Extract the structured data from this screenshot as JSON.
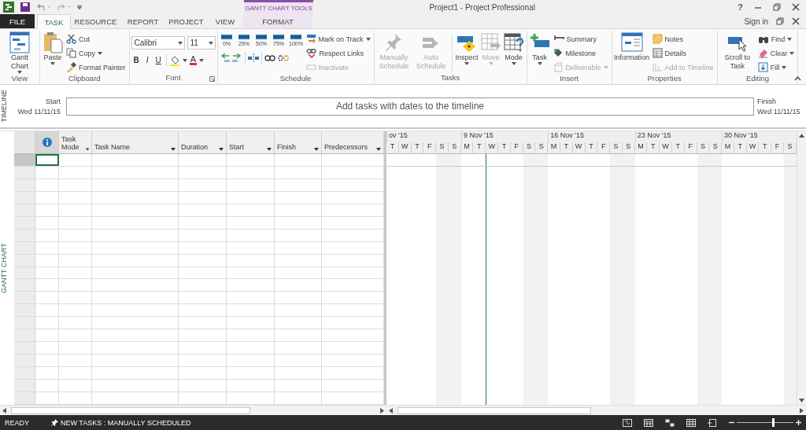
{
  "title_bar": {
    "contextual_group": "GANTT CHART TOOLS",
    "title": "Project1 - Project Professional",
    "help": "?"
  },
  "tabs": [
    {
      "label": "FILE",
      "kind": "file",
      "selected": false
    },
    {
      "label": "TASK",
      "kind": "normal",
      "selected": true
    },
    {
      "label": "RESOURCE",
      "kind": "normal",
      "selected": false
    },
    {
      "label": "REPORT",
      "kind": "normal",
      "selected": false
    },
    {
      "label": "PROJECT",
      "kind": "normal",
      "selected": false
    },
    {
      "label": "VIEW",
      "kind": "normal",
      "selected": false
    },
    {
      "label": "FORMAT",
      "kind": "contextual",
      "selected": false
    }
  ],
  "account": {
    "sign_in": "Sign in"
  },
  "ribbon_groups": [
    {
      "label": "View",
      "items": [
        {
          "kind": "large",
          "label": "Gantt Chart",
          "dropdown": true,
          "disabled": false
        }
      ]
    },
    {
      "label": "Clipboard",
      "items": [
        {
          "kind": "large",
          "label": "Paste",
          "dropdown": true,
          "disabled": false
        },
        {
          "kind": "stack",
          "entries": [
            {
              "label": "Cut",
              "dropdown": false,
              "disabled": false
            },
            {
              "label": "Copy",
              "dropdown": true,
              "disabled": false
            },
            {
              "label": "Format Painter",
              "dropdown": false,
              "disabled": false
            }
          ]
        }
      ]
    },
    {
      "label": "Font",
      "launcher": true,
      "items": [
        {
          "kind": "font",
          "font_name": "Calibri",
          "font_size": "11",
          "styles": [
            "B",
            "I",
            "U"
          ],
          "font_color_label": "A"
        }
      ]
    },
    {
      "label": "Schedule",
      "items": [
        {
          "kind": "schedule",
          "percent_buttons": [
            "0%",
            "25%",
            "50%",
            "75%",
            "100%"
          ]
        },
        {
          "kind": "stack",
          "entries": [
            {
              "label": "Mark on Track",
              "dropdown": true,
              "disabled": false
            },
            {
              "label": "Respect Links",
              "dropdown": false,
              "disabled": false
            },
            {
              "label": "Inactivate",
              "dropdown": false,
              "disabled": true
            }
          ]
        }
      ]
    },
    {
      "label": "Tasks",
      "items": [
        {
          "kind": "large",
          "label": "Manually Schedule",
          "dropdown": false,
          "disabled": true
        },
        {
          "kind": "large",
          "label": "Auto Schedule",
          "dropdown": false,
          "disabled": true
        },
        {
          "kind": "separator"
        },
        {
          "kind": "large",
          "label": "Inspect",
          "dropdown": true,
          "disabled": false
        },
        {
          "kind": "large",
          "label": "Move",
          "dropdown": true,
          "disabled": true
        },
        {
          "kind": "large",
          "label": "Mode",
          "dropdown": true,
          "disabled": false
        }
      ]
    },
    {
      "label": "Insert",
      "items": [
        {
          "kind": "large",
          "label": "Task",
          "dropdown": true,
          "disabled": false
        },
        {
          "kind": "stack",
          "entries": [
            {
              "label": "Summary",
              "dropdown": false,
              "disabled": false
            },
            {
              "label": "Milestone",
              "dropdown": false,
              "disabled": false
            },
            {
              "label": "Deliverable",
              "dropdown": true,
              "disabled": true
            }
          ]
        }
      ]
    },
    {
      "label": "Properties",
      "items": [
        {
          "kind": "large",
          "label": "Information",
          "dropdown": false,
          "disabled": false
        },
        {
          "kind": "stack",
          "entries": [
            {
              "label": "Notes",
              "dropdown": false,
              "disabled": false
            },
            {
              "label": "Details",
              "dropdown": false,
              "disabled": false
            },
            {
              "label": "Add to Timeline",
              "dropdown": false,
              "disabled": true
            }
          ]
        }
      ]
    },
    {
      "label": "Editing",
      "items": [
        {
          "kind": "large",
          "label": "Scroll to Task",
          "dropdown": false,
          "disabled": false
        },
        {
          "kind": "stack",
          "entries": [
            {
              "label": "Find",
              "dropdown": true,
              "disabled": false
            },
            {
              "label": "Clear",
              "dropdown": true,
              "disabled": false
            },
            {
              "label": "Fill",
              "dropdown": true,
              "disabled": false
            }
          ]
        }
      ]
    }
  ],
  "timeline": {
    "side_label": "TIMELINE",
    "start_label": "Start",
    "start_date": "Wed 11/11/15",
    "placeholder_text": "Add tasks with dates to the timeline",
    "finish_label": "Finish",
    "finish_date": "Wed 11/11/15"
  },
  "gantt_view": {
    "side_label": "GANTT CHART",
    "columns": [
      {
        "kind": "indicator"
      },
      {
        "kind": "text",
        "label": "Task Mode"
      },
      {
        "kind": "text",
        "label": "Task Name"
      },
      {
        "kind": "text",
        "label": "Duration"
      },
      {
        "kind": "text",
        "label": "Start"
      },
      {
        "kind": "text",
        "label": "Finish"
      },
      {
        "kind": "text",
        "label": "Predecessors"
      }
    ],
    "rows": [
      {
        "selected": true
      },
      {
        "selected": false
      },
      {
        "selected": false
      },
      {
        "selected": false
      },
      {
        "selected": false
      },
      {
        "selected": false
      },
      {
        "selected": false
      },
      {
        "selected": false
      },
      {
        "selected": false
      },
      {
        "selected": false
      },
      {
        "selected": false
      },
      {
        "selected": false
      },
      {
        "selected": false
      },
      {
        "selected": false
      },
      {
        "selected": false
      },
      {
        "selected": false
      },
      {
        "selected": false
      },
      {
        "selected": false
      },
      {
        "selected": false
      },
      {
        "selected": false
      }
    ],
    "weeks": [
      {
        "label": "ov '15",
        "days": [
          {
            "label": "T"
          },
          {
            "label": "W"
          },
          {
            "label": "T"
          },
          {
            "label": "F"
          },
          {
            "label": "S",
            "nonworking": true
          },
          {
            "label": "S",
            "nonworking": true
          }
        ]
      },
      {
        "label": "9 Nov '15",
        "days": [
          {
            "label": "M"
          },
          {
            "label": "T"
          },
          {
            "label": "W",
            "today": true
          },
          {
            "label": "T"
          },
          {
            "label": "F"
          },
          {
            "label": "S",
            "nonworking": true
          },
          {
            "label": "S",
            "nonworking": true
          }
        ]
      },
      {
        "label": "16 Nov '15",
        "days": [
          {
            "label": "M"
          },
          {
            "label": "T"
          },
          {
            "label": "W"
          },
          {
            "label": "T"
          },
          {
            "label": "F"
          },
          {
            "label": "S",
            "nonworking": true
          },
          {
            "label": "S",
            "nonworking": true
          }
        ]
      },
      {
        "label": "23 Nov '15",
        "days": [
          {
            "label": "M"
          },
          {
            "label": "T"
          },
          {
            "label": "W"
          },
          {
            "label": "T"
          },
          {
            "label": "F"
          },
          {
            "label": "S",
            "nonworking": true
          },
          {
            "label": "S",
            "nonworking": true
          }
        ]
      },
      {
        "label": "30 Nov '15",
        "days": [
          {
            "label": "M"
          },
          {
            "label": "T"
          },
          {
            "label": "W"
          },
          {
            "label": "T"
          },
          {
            "label": "F"
          },
          {
            "label": "S",
            "nonworking": true
          }
        ]
      }
    ]
  },
  "status_bar": {
    "ready": "READY",
    "new_tasks": "NEW TASKS : MANUALLY SCHEDULED",
    "zoom": {
      "level": 0.65
    }
  }
}
